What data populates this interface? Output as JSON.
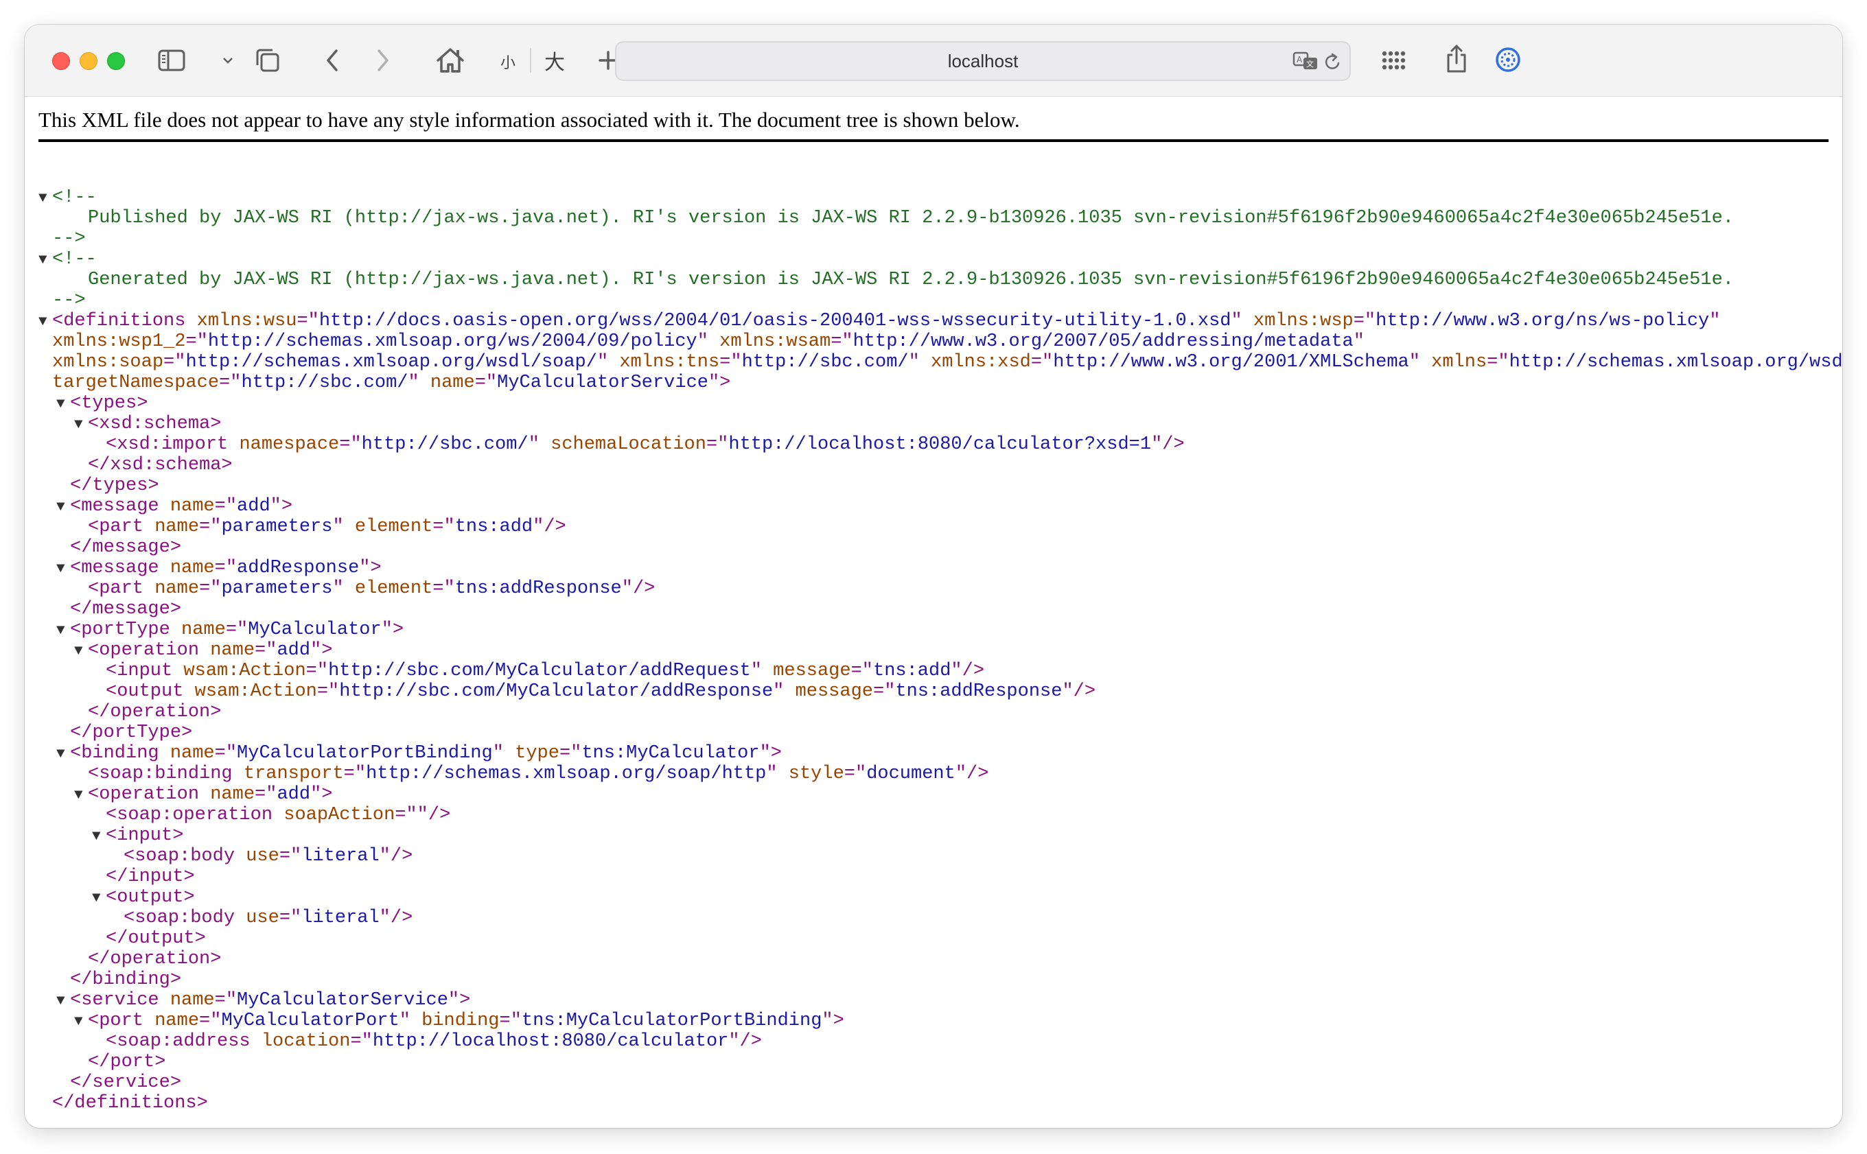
{
  "browser": {
    "address": "localhost",
    "font_small_label": "小",
    "font_large_label": "大",
    "icons": [
      "sidebar-icon",
      "chevron-down-icon",
      "tabs-overview-icon",
      "back-icon",
      "forward-icon",
      "home-icon",
      "new-tab-icon",
      "translate-icon",
      "reload-icon",
      "grid-icon",
      "share-icon",
      "extension-icon"
    ],
    "colors": {
      "close": "#ff5f57",
      "minimize": "#febc2e",
      "zoom": "#28c840",
      "tag": "#881280",
      "attr_name": "#994500",
      "attr_value": "#1a1aa6",
      "comment": "#236e25"
    }
  },
  "page": {
    "info_message": "This XML file does not appear to have any style information associated with it. The document tree is shown below."
  },
  "xml_lines": [
    {
      "indent": 0,
      "toggle": true,
      "parts": [
        [
          "cm",
          "<!--"
        ]
      ]
    },
    {
      "indent": 2,
      "toggle": false,
      "parts": [
        [
          "cm",
          "Published by JAX-WS RI (http://jax-ws.java.net). RI's version is JAX-WS RI 2.2.9-b130926.1035 svn-revision#5f6196f2b90e9460065a4c2f4e30e065b245e51e."
        ]
      ]
    },
    {
      "indent": 0,
      "toggle": false,
      "parts": [
        [
          "cm",
          "-->"
        ]
      ]
    },
    {
      "indent": 0,
      "toggle": true,
      "parts": [
        [
          "cm",
          "<!--"
        ]
      ]
    },
    {
      "indent": 2,
      "toggle": false,
      "parts": [
        [
          "cm",
          "Generated by JAX-WS RI (http://jax-ws.java.net). RI's version is JAX-WS RI 2.2.9-b130926.1035 svn-revision#5f6196f2b90e9460065a4c2f4e30e065b245e51e."
        ]
      ]
    },
    {
      "indent": 0,
      "toggle": false,
      "parts": [
        [
          "cm",
          "-->"
        ]
      ]
    },
    {
      "indent": 0,
      "toggle": true,
      "parts": [
        [
          "tag",
          "<definitions"
        ],
        [
          "tx",
          " "
        ],
        [
          "an",
          "xmlns:wsu"
        ],
        [
          "tag",
          "=\""
        ],
        [
          "av",
          "http://docs.oasis-open.org/wss/2004/01/oasis-200401-wss-wssecurity-utility-1.0.xsd"
        ],
        [
          "tag",
          "\""
        ],
        [
          "tx",
          " "
        ],
        [
          "an",
          "xmlns:wsp"
        ],
        [
          "tag",
          "=\""
        ],
        [
          "av",
          "http://www.w3.org/ns/ws-policy"
        ],
        [
          "tag",
          "\""
        ]
      ]
    },
    {
      "indent": 0,
      "toggle": false,
      "parts": [
        [
          "an",
          "xmlns:wsp1_2"
        ],
        [
          "tag",
          "=\""
        ],
        [
          "av",
          "http://schemas.xmlsoap.org/ws/2004/09/policy"
        ],
        [
          "tag",
          "\""
        ],
        [
          "tx",
          " "
        ],
        [
          "an",
          "xmlns:wsam"
        ],
        [
          "tag",
          "=\""
        ],
        [
          "av",
          "http://www.w3.org/2007/05/addressing/metadata"
        ],
        [
          "tag",
          "\""
        ]
      ]
    },
    {
      "indent": 0,
      "toggle": false,
      "parts": [
        [
          "an",
          "xmlns:soap"
        ],
        [
          "tag",
          "=\""
        ],
        [
          "av",
          "http://schemas.xmlsoap.org/wsdl/soap/"
        ],
        [
          "tag",
          "\""
        ],
        [
          "tx",
          " "
        ],
        [
          "an",
          "xmlns:tns"
        ],
        [
          "tag",
          "=\""
        ],
        [
          "av",
          "http://sbc.com/"
        ],
        [
          "tag",
          "\""
        ],
        [
          "tx",
          " "
        ],
        [
          "an",
          "xmlns:xsd"
        ],
        [
          "tag",
          "=\""
        ],
        [
          "av",
          "http://www.w3.org/2001/XMLSchema"
        ],
        [
          "tag",
          "\""
        ],
        [
          "tx",
          " "
        ],
        [
          "an",
          "xmlns"
        ],
        [
          "tag",
          "=\""
        ],
        [
          "av",
          "http://schemas.xmlsoap.org/wsdl/"
        ],
        [
          "tag",
          "\""
        ]
      ]
    },
    {
      "indent": 0,
      "toggle": false,
      "parts": [
        [
          "an",
          "targetNamespace"
        ],
        [
          "tag",
          "=\""
        ],
        [
          "av",
          "http://sbc.com/"
        ],
        [
          "tag",
          "\""
        ],
        [
          "tx",
          " "
        ],
        [
          "an",
          "name"
        ],
        [
          "tag",
          "=\""
        ],
        [
          "av",
          "MyCalculatorService"
        ],
        [
          "tag",
          "\">"
        ]
      ]
    },
    {
      "indent": 1,
      "toggle": true,
      "parts": [
        [
          "tag",
          "<types>"
        ]
      ]
    },
    {
      "indent": 2,
      "toggle": true,
      "parts": [
        [
          "tag",
          "<xsd:schema>"
        ]
      ]
    },
    {
      "indent": 3,
      "toggle": false,
      "parts": [
        [
          "tag",
          "<xsd:import"
        ],
        [
          "tx",
          " "
        ],
        [
          "an",
          "namespace"
        ],
        [
          "tag",
          "=\""
        ],
        [
          "av",
          "http://sbc.com/"
        ],
        [
          "tag",
          "\""
        ],
        [
          "tx",
          " "
        ],
        [
          "an",
          "schemaLocation"
        ],
        [
          "tag",
          "=\""
        ],
        [
          "av",
          "http://localhost:8080/calculator?xsd=1"
        ],
        [
          "tag",
          "\"/>"
        ]
      ]
    },
    {
      "indent": 2,
      "toggle": false,
      "parts": [
        [
          "tag",
          "</xsd:schema>"
        ]
      ]
    },
    {
      "indent": 1,
      "toggle": false,
      "parts": [
        [
          "tag",
          "</types>"
        ]
      ]
    },
    {
      "indent": 1,
      "toggle": true,
      "parts": [
        [
          "tag",
          "<message"
        ],
        [
          "tx",
          " "
        ],
        [
          "an",
          "name"
        ],
        [
          "tag",
          "=\""
        ],
        [
          "av",
          "add"
        ],
        [
          "tag",
          "\">"
        ]
      ]
    },
    {
      "indent": 2,
      "toggle": false,
      "parts": [
        [
          "tag",
          "<part"
        ],
        [
          "tx",
          " "
        ],
        [
          "an",
          "name"
        ],
        [
          "tag",
          "=\""
        ],
        [
          "av",
          "parameters"
        ],
        [
          "tag",
          "\""
        ],
        [
          "tx",
          " "
        ],
        [
          "an",
          "element"
        ],
        [
          "tag",
          "=\""
        ],
        [
          "av",
          "tns:add"
        ],
        [
          "tag",
          "\"/>"
        ]
      ]
    },
    {
      "indent": 1,
      "toggle": false,
      "parts": [
        [
          "tag",
          "</message>"
        ]
      ]
    },
    {
      "indent": 1,
      "toggle": true,
      "parts": [
        [
          "tag",
          "<message"
        ],
        [
          "tx",
          " "
        ],
        [
          "an",
          "name"
        ],
        [
          "tag",
          "=\""
        ],
        [
          "av",
          "addResponse"
        ],
        [
          "tag",
          "\">"
        ]
      ]
    },
    {
      "indent": 2,
      "toggle": false,
      "parts": [
        [
          "tag",
          "<part"
        ],
        [
          "tx",
          " "
        ],
        [
          "an",
          "name"
        ],
        [
          "tag",
          "=\""
        ],
        [
          "av",
          "parameters"
        ],
        [
          "tag",
          "\""
        ],
        [
          "tx",
          " "
        ],
        [
          "an",
          "element"
        ],
        [
          "tag",
          "=\""
        ],
        [
          "av",
          "tns:addResponse"
        ],
        [
          "tag",
          "\"/>"
        ]
      ]
    },
    {
      "indent": 1,
      "toggle": false,
      "parts": [
        [
          "tag",
          "</message>"
        ]
      ]
    },
    {
      "indent": 1,
      "toggle": true,
      "parts": [
        [
          "tag",
          "<portType"
        ],
        [
          "tx",
          " "
        ],
        [
          "an",
          "name"
        ],
        [
          "tag",
          "=\""
        ],
        [
          "av",
          "MyCalculator"
        ],
        [
          "tag",
          "\">"
        ]
      ]
    },
    {
      "indent": 2,
      "toggle": true,
      "parts": [
        [
          "tag",
          "<operation"
        ],
        [
          "tx",
          " "
        ],
        [
          "an",
          "name"
        ],
        [
          "tag",
          "=\""
        ],
        [
          "av",
          "add"
        ],
        [
          "tag",
          "\">"
        ]
      ]
    },
    {
      "indent": 3,
      "toggle": false,
      "parts": [
        [
          "tag",
          "<input"
        ],
        [
          "tx",
          " "
        ],
        [
          "an",
          "wsam:Action"
        ],
        [
          "tag",
          "=\""
        ],
        [
          "av",
          "http://sbc.com/MyCalculator/addRequest"
        ],
        [
          "tag",
          "\""
        ],
        [
          "tx",
          " "
        ],
        [
          "an",
          "message"
        ],
        [
          "tag",
          "=\""
        ],
        [
          "av",
          "tns:add"
        ],
        [
          "tag",
          "\"/>"
        ]
      ]
    },
    {
      "indent": 3,
      "toggle": false,
      "parts": [
        [
          "tag",
          "<output"
        ],
        [
          "tx",
          " "
        ],
        [
          "an",
          "wsam:Action"
        ],
        [
          "tag",
          "=\""
        ],
        [
          "av",
          "http://sbc.com/MyCalculator/addResponse"
        ],
        [
          "tag",
          "\""
        ],
        [
          "tx",
          " "
        ],
        [
          "an",
          "message"
        ],
        [
          "tag",
          "=\""
        ],
        [
          "av",
          "tns:addResponse"
        ],
        [
          "tag",
          "\"/>"
        ]
      ]
    },
    {
      "indent": 2,
      "toggle": false,
      "parts": [
        [
          "tag",
          "</operation>"
        ]
      ]
    },
    {
      "indent": 1,
      "toggle": false,
      "parts": [
        [
          "tag",
          "</portType>"
        ]
      ]
    },
    {
      "indent": 1,
      "toggle": true,
      "parts": [
        [
          "tag",
          "<binding"
        ],
        [
          "tx",
          " "
        ],
        [
          "an",
          "name"
        ],
        [
          "tag",
          "=\""
        ],
        [
          "av",
          "MyCalculatorPortBinding"
        ],
        [
          "tag",
          "\""
        ],
        [
          "tx",
          " "
        ],
        [
          "an",
          "type"
        ],
        [
          "tag",
          "=\""
        ],
        [
          "av",
          "tns:MyCalculator"
        ],
        [
          "tag",
          "\">"
        ]
      ]
    },
    {
      "indent": 2,
      "toggle": false,
      "parts": [
        [
          "tag",
          "<soap:binding"
        ],
        [
          "tx",
          " "
        ],
        [
          "an",
          "transport"
        ],
        [
          "tag",
          "=\""
        ],
        [
          "av",
          "http://schemas.xmlsoap.org/soap/http"
        ],
        [
          "tag",
          "\""
        ],
        [
          "tx",
          " "
        ],
        [
          "an",
          "style"
        ],
        [
          "tag",
          "=\""
        ],
        [
          "av",
          "document"
        ],
        [
          "tag",
          "\"/>"
        ]
      ]
    },
    {
      "indent": 2,
      "toggle": true,
      "parts": [
        [
          "tag",
          "<operation"
        ],
        [
          "tx",
          " "
        ],
        [
          "an",
          "name"
        ],
        [
          "tag",
          "=\""
        ],
        [
          "av",
          "add"
        ],
        [
          "tag",
          "\">"
        ]
      ]
    },
    {
      "indent": 3,
      "toggle": false,
      "parts": [
        [
          "tag",
          "<soap:operation"
        ],
        [
          "tx",
          " "
        ],
        [
          "an",
          "soapAction"
        ],
        [
          "tag",
          "=\"\"/>"
        ]
      ]
    },
    {
      "indent": 3,
      "toggle": true,
      "parts": [
        [
          "tag",
          "<input>"
        ]
      ]
    },
    {
      "indent": 4,
      "toggle": false,
      "parts": [
        [
          "tag",
          "<soap:body"
        ],
        [
          "tx",
          " "
        ],
        [
          "an",
          "use"
        ],
        [
          "tag",
          "=\""
        ],
        [
          "av",
          "literal"
        ],
        [
          "tag",
          "\"/>"
        ]
      ]
    },
    {
      "indent": 3,
      "toggle": false,
      "parts": [
        [
          "tag",
          "</input>"
        ]
      ]
    },
    {
      "indent": 3,
      "toggle": true,
      "parts": [
        [
          "tag",
          "<output>"
        ]
      ]
    },
    {
      "indent": 4,
      "toggle": false,
      "parts": [
        [
          "tag",
          "<soap:body"
        ],
        [
          "tx",
          " "
        ],
        [
          "an",
          "use"
        ],
        [
          "tag",
          "=\""
        ],
        [
          "av",
          "literal"
        ],
        [
          "tag",
          "\"/>"
        ]
      ]
    },
    {
      "indent": 3,
      "toggle": false,
      "parts": [
        [
          "tag",
          "</output>"
        ]
      ]
    },
    {
      "indent": 2,
      "toggle": false,
      "parts": [
        [
          "tag",
          "</operation>"
        ]
      ]
    },
    {
      "indent": 1,
      "toggle": false,
      "parts": [
        [
          "tag",
          "</binding>"
        ]
      ]
    },
    {
      "indent": 1,
      "toggle": true,
      "parts": [
        [
          "tag",
          "<service"
        ],
        [
          "tx",
          " "
        ],
        [
          "an",
          "name"
        ],
        [
          "tag",
          "=\""
        ],
        [
          "av",
          "MyCalculatorService"
        ],
        [
          "tag",
          "\">"
        ]
      ]
    },
    {
      "indent": 2,
      "toggle": true,
      "parts": [
        [
          "tag",
          "<port"
        ],
        [
          "tx",
          " "
        ],
        [
          "an",
          "name"
        ],
        [
          "tag",
          "=\""
        ],
        [
          "av",
          "MyCalculatorPort"
        ],
        [
          "tag",
          "\""
        ],
        [
          "tx",
          " "
        ],
        [
          "an",
          "binding"
        ],
        [
          "tag",
          "=\""
        ],
        [
          "av",
          "tns:MyCalculatorPortBinding"
        ],
        [
          "tag",
          "\">"
        ]
      ]
    },
    {
      "indent": 3,
      "toggle": false,
      "parts": [
        [
          "tag",
          "<soap:address"
        ],
        [
          "tx",
          " "
        ],
        [
          "an",
          "location"
        ],
        [
          "tag",
          "=\""
        ],
        [
          "av",
          "http://localhost:8080/calculator"
        ],
        [
          "tag",
          "\"/>"
        ]
      ]
    },
    {
      "indent": 2,
      "toggle": false,
      "parts": [
        [
          "tag",
          "</port>"
        ]
      ]
    },
    {
      "indent": 1,
      "toggle": false,
      "parts": [
        [
          "tag",
          "</service>"
        ]
      ]
    },
    {
      "indent": 0,
      "toggle": false,
      "parts": [
        [
          "tag",
          "</definitions>"
        ]
      ]
    }
  ]
}
